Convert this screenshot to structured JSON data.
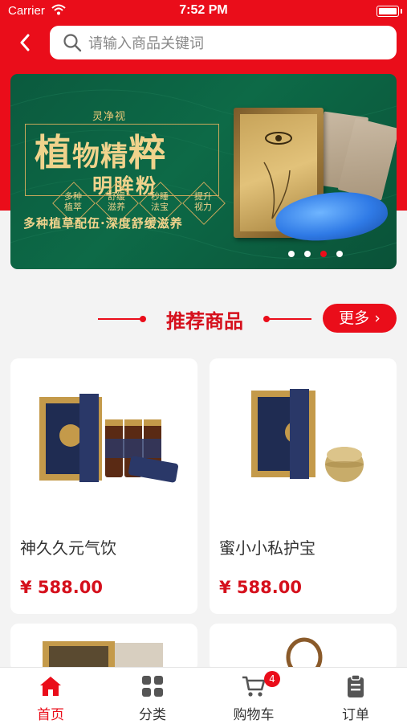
{
  "status_bar": {
    "carrier": "Carrier",
    "time": "7:52 PM"
  },
  "search": {
    "placeholder": "请输入商品关键词",
    "value": ""
  },
  "banner": {
    "brand": "灵净视",
    "title_part1": "植",
    "title_part2": "物精",
    "title_part3": "粹",
    "subtitle": "明眸粉",
    "features": [
      "多种\n植萃",
      "舒缓\n滋养",
      "秒睡\n法宝",
      "提升\n视力"
    ],
    "tagline": "多种植草配伍·深度舒缓滋养",
    "carousel_total": 4,
    "carousel_active_index": 2
  },
  "section": {
    "title": "推荐商品",
    "more_label": "更多 ›"
  },
  "products": [
    {
      "name": "神久久元气饮",
      "price": "¥ 588.00"
    },
    {
      "name": "蜜小小私护宝",
      "price": "¥ 588.00"
    },
    {
      "name": "",
      "price": ""
    },
    {
      "name": "",
      "price": ""
    }
  ],
  "tabbar": {
    "items": [
      {
        "label": "首页",
        "icon": "home-icon",
        "active": true
      },
      {
        "label": "分类",
        "icon": "grid-icon",
        "active": false
      },
      {
        "label": "购物车",
        "icon": "cart-icon",
        "active": false
      },
      {
        "label": "订单",
        "icon": "clipboard-icon",
        "active": false
      }
    ],
    "cart_badge": "4"
  },
  "colors": {
    "brand_red": "#ea0d1a",
    "price_red": "#d5101c",
    "banner_green": "#0d6a47",
    "gold": "#f0d38c"
  }
}
